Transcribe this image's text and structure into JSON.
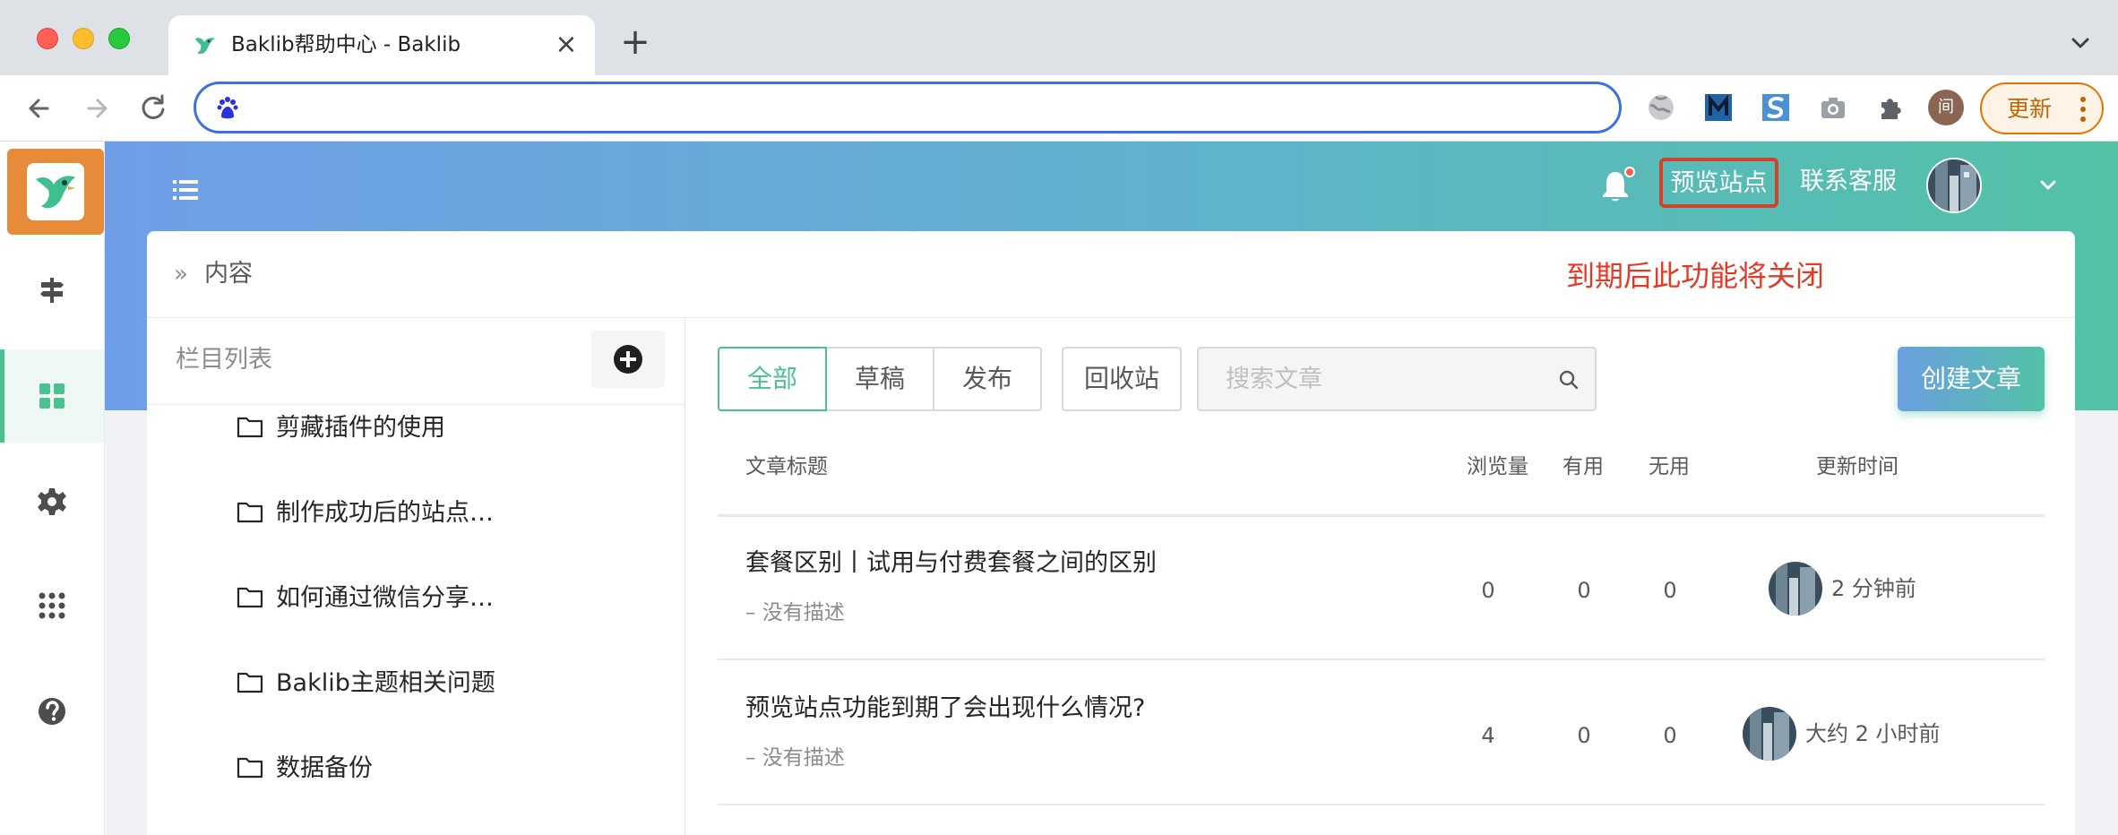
{
  "browser": {
    "tab_title": "Baklib帮助中心 - Baklib",
    "tab_close_label": "×",
    "new_tab_label": "+",
    "address_value": "",
    "update_label": "更新",
    "profile_initial": "间"
  },
  "app": {
    "colors": {
      "accent": "#4cc08f",
      "header_gradient_start": "#6f9ee8",
      "header_gradient_end": "#52c2a6",
      "warning": "#e33a27",
      "logo_bg": "#e68b3a"
    },
    "sidebar": {
      "items": [
        {
          "icon": "signpost-icon",
          "active": false
        },
        {
          "icon": "grid-icon",
          "active": true
        },
        {
          "icon": "gear-icon",
          "active": false
        },
        {
          "icon": "apps-dots-icon",
          "active": false
        },
        {
          "icon": "help-icon",
          "active": false
        }
      ]
    },
    "header": {
      "preview_site": "预览站点",
      "contact_support": "联系客服"
    },
    "breadcrumb": {
      "separator": "»",
      "current": "内容"
    },
    "warning_note": "到期后此功能将关闭",
    "column_panel": {
      "title": "栏目列表",
      "folders": [
        "剪藏插件的使用",
        "制作成功后的站点…",
        "如何通过微信分享…",
        "Baklib主题相关问题",
        "数据备份"
      ]
    },
    "filters": {
      "all": "全部",
      "draft": "草稿",
      "published": "发布",
      "trash": "回收站",
      "active": "all"
    },
    "search": {
      "placeholder": "搜索文章",
      "value": ""
    },
    "create_button": "创建文章",
    "table": {
      "headers": {
        "title": "文章标题",
        "views": "浏览量",
        "useful": "有用",
        "useless": "无用",
        "updated": "更新时间"
      },
      "rows": [
        {
          "title": "套餐区别丨试用与付费套餐之间的区别",
          "description": "– 没有描述",
          "views": "0",
          "useful": "0",
          "useless": "0",
          "updated": "2 分钟前"
        },
        {
          "title": "预览站点功能到期了会出现什么情况?",
          "description": "– 没有描述",
          "views": "4",
          "useful": "0",
          "useless": "0",
          "updated": "大约 2 小时前"
        }
      ]
    }
  }
}
